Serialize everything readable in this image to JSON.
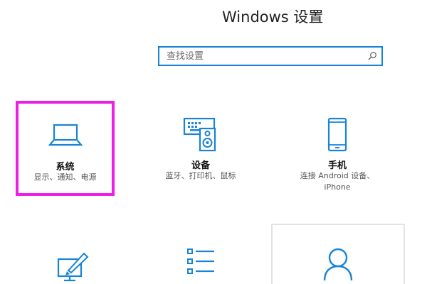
{
  "header": {
    "title": "Windows 设置"
  },
  "search": {
    "placeholder": "查找设置",
    "value": "",
    "icon": "search-icon"
  },
  "accent_color": "#1883d7",
  "highlight_color": "#ee1ee4",
  "tiles": [
    {
      "icon": "laptop-icon",
      "title": "系统",
      "desc": "显示、通知、电源",
      "highlighted": true
    },
    {
      "icon": "devices-icon",
      "title": "设备",
      "desc": "蓝牙、打印机、鼠标"
    },
    {
      "icon": "phone-icon",
      "title": "手机",
      "desc_line1": "连接 Android 设备、",
      "desc_line2": "iPhone"
    },
    {
      "icon": "personalization-icon"
    },
    {
      "icon": "apps-icon"
    },
    {
      "icon": "account-icon",
      "hover_border": true
    }
  ]
}
